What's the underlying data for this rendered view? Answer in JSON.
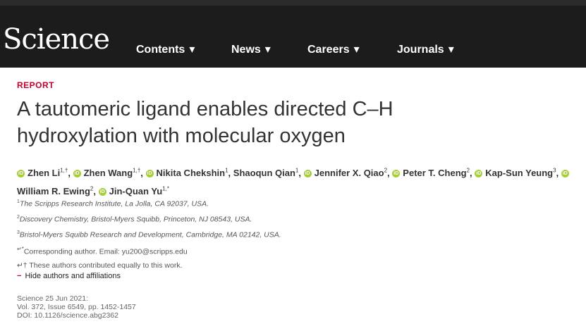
{
  "nav": {
    "logo": "Science",
    "items": [
      {
        "label": "Contents",
        "caret": "▾"
      },
      {
        "label": "News",
        "caret": "▾"
      },
      {
        "label": "Careers",
        "caret": "▾"
      },
      {
        "label": "Journals",
        "caret": "▾"
      }
    ]
  },
  "article": {
    "kicker": "REPORT",
    "title_line1": "A tautomeric ligand enables directed C–H",
    "title_line2": "hydroxylation with molecular oxygen",
    "authors": [
      {
        "name": "Zhen Li",
        "sup": "1,†",
        "sep": ","
      },
      {
        "name": "Zhen Wang",
        "sup": "1,†",
        "sep": ","
      },
      {
        "name": "Nikita Chekshin",
        "sup": "1",
        "sep": ","
      },
      {
        "name": "Shaoqun Qian",
        "sup": "1",
        "sep": ","
      },
      {
        "name": "Jennifer X. Qiao",
        "sup": "2",
        "sep": ","
      },
      {
        "name": "Peter T. Cheng",
        "sup": "2",
        "sep": ","
      },
      {
        "name": "Kap-Sun Yeung",
        "sup": "3",
        "sep": ","
      },
      {
        "name": "William R. Ewing",
        "sup": "2",
        "sep": ","
      },
      {
        "name": "Jin-Quan Yu",
        "sup": "1,*",
        "sep": ""
      }
    ],
    "affiliations": [
      {
        "sup": "1",
        "text": "The Scripps Research Institute, La Jolla, CA 92037, USA."
      },
      {
        "sup": "2",
        "text": "Discovery Chemistry, Bristol-Myers Squibb, Princeton, NJ 08543, USA."
      },
      {
        "sup": "3",
        "text": "Bristol-Myers Squibb Research and Development, Cambridge, MA 02142, USA."
      }
    ],
    "corresponding": "Corresponding author. Email: yu200@scripps.edu",
    "equal": "↵† These authors contributed equally to this work.",
    "hide_label": "Hide authors and affiliations",
    "meta_line1": "Science  25 Jun 2021:",
    "meta_line2": "Vol. 372, Issue 6549, pp. 1452-1457",
    "meta_line3": "DOI: 10.1126/science.abg2362"
  },
  "colors": {
    "accent": "#c0002a",
    "orcid": "#a6ce39",
    "nav_bg": "#1c1c1c"
  }
}
